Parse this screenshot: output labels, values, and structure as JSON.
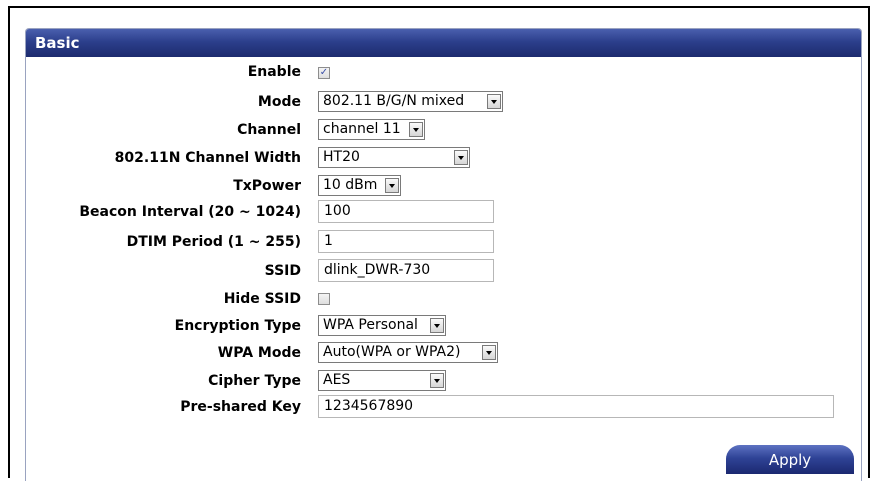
{
  "panel": {
    "title": "Basic"
  },
  "fields": {
    "enable": {
      "label": "Enable",
      "checked": true
    },
    "mode": {
      "label": "Mode",
      "value": "802.11 B/G/N mixed"
    },
    "channel": {
      "label": "Channel",
      "value": "channel 11"
    },
    "channel_width": {
      "label": "802.11N Channel Width",
      "value": "HT20"
    },
    "txpower": {
      "label": "TxPower",
      "value": "10 dBm"
    },
    "beacon_interval": {
      "label": "Beacon Interval (20 ~ 1024)",
      "value": "100"
    },
    "dtim_period": {
      "label": "DTIM Period (1 ~ 255)",
      "value": "1"
    },
    "ssid": {
      "label": "SSID",
      "value": "dlink_DWR-730"
    },
    "hide_ssid": {
      "label": "Hide SSID",
      "checked": false
    },
    "encryption_type": {
      "label": "Encryption Type",
      "value": "WPA Personal"
    },
    "wpa_mode": {
      "label": "WPA Mode",
      "value": "Auto(WPA or WPA2)"
    },
    "cipher_type": {
      "label": "Cipher Type",
      "value": "AES"
    },
    "preshared_key": {
      "label": "Pre-shared Key",
      "value": "1234567890"
    }
  },
  "actions": {
    "apply_label": "Apply"
  },
  "colors": {
    "header": "#2c3f8c",
    "button": "#2f4396"
  }
}
